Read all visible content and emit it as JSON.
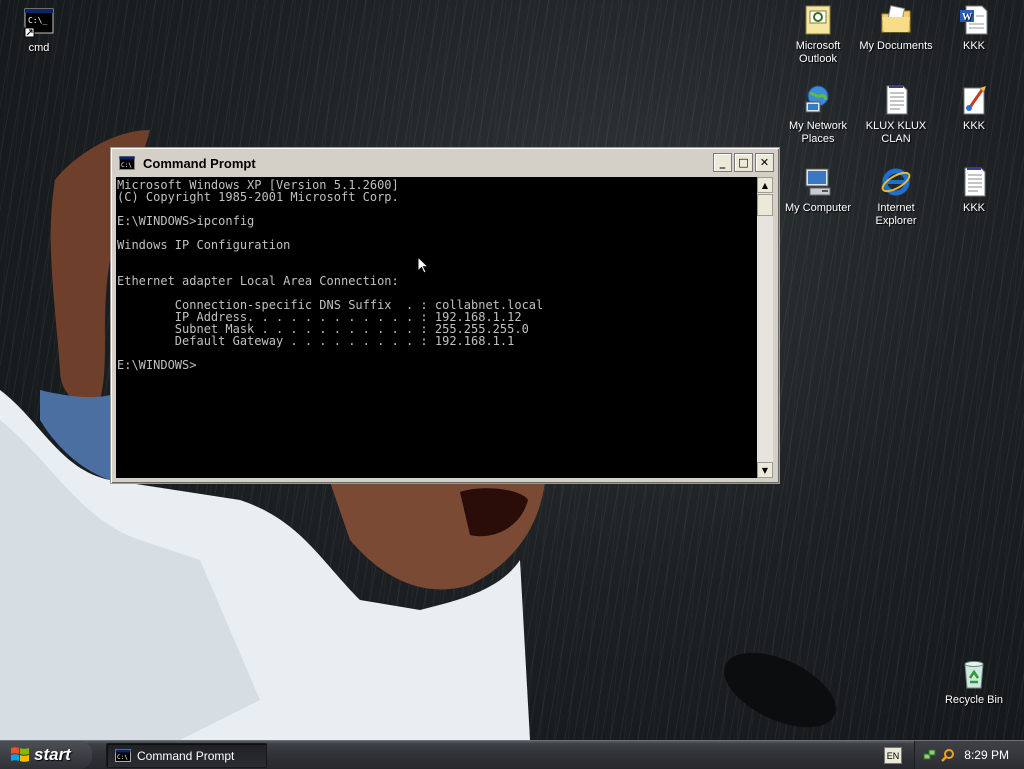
{
  "desktop": {
    "icons": [
      {
        "label": "cmd",
        "icon": "cmd-shortcut-icon"
      },
      {
        "label": "Microsoft Outlook",
        "icon": "outlook-icon"
      },
      {
        "label": "My Documents",
        "icon": "my-documents-icon"
      },
      {
        "label": "KKK",
        "icon": "word-document-icon"
      },
      {
        "label": "My Network Places",
        "icon": "network-places-icon"
      },
      {
        "label": "KLUX KLUX CLAN",
        "icon": "text-document-icon"
      },
      {
        "label": "KKK",
        "icon": "paint-icon"
      },
      {
        "label": "My Computer",
        "icon": "my-computer-icon"
      },
      {
        "label": "Internet Explorer",
        "icon": "internet-explorer-icon"
      },
      {
        "label": "KKK",
        "icon": "text-document-icon"
      },
      {
        "label": "Recycle Bin",
        "icon": "recycle-bin-icon"
      }
    ]
  },
  "window": {
    "title": "Command Prompt",
    "buttons": {
      "minimize": "_",
      "maximize": "□",
      "close": "✕"
    },
    "console_lines": [
      "Microsoft Windows XP [Version 5.1.2600]",
      "(C) Copyright 1985-2001 Microsoft Corp.",
      "",
      "E:\\WINDOWS>ipconfig",
      "",
      "Windows IP Configuration",
      "",
      "",
      "Ethernet adapter Local Area Connection:",
      "",
      "        Connection-specific DNS Suffix  . : collabnet.local",
      "        IP Address. . . . . . . . . . . . : 192.168.1.12",
      "        Subnet Mask . . . . . . . . . . . : 255.255.255.0",
      "        Default Gateway . . . . . . . . . : 192.168.1.1",
      "",
      "E:\\WINDOWS>"
    ]
  },
  "taskbar": {
    "start_label": "start",
    "task_item_label": "Command Prompt",
    "language": "EN",
    "clock": "8:29 PM"
  }
}
